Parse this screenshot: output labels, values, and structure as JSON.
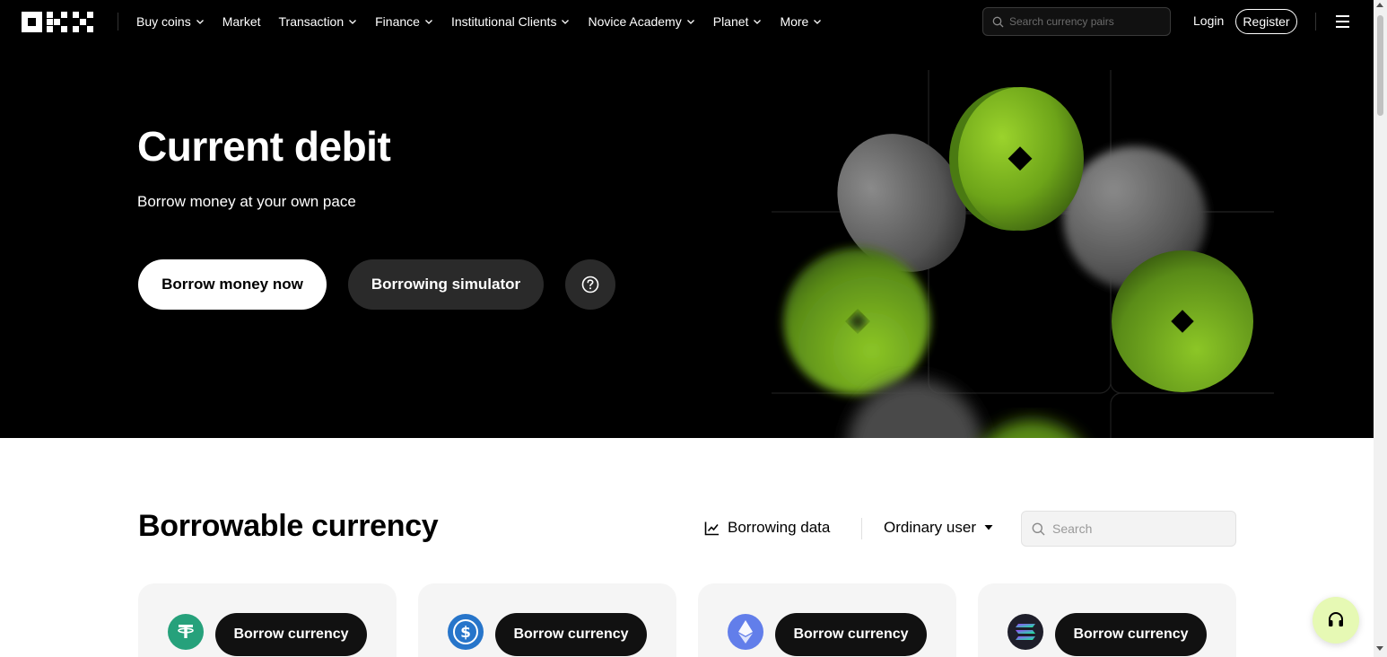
{
  "nav": {
    "items": [
      {
        "label": "Buy coins",
        "has_dropdown": true
      },
      {
        "label": "Market",
        "has_dropdown": false
      },
      {
        "label": "Transaction",
        "has_dropdown": true
      },
      {
        "label": "Finance",
        "has_dropdown": true
      },
      {
        "label": "Institutional Clients",
        "has_dropdown": true
      },
      {
        "label": "Novice Academy",
        "has_dropdown": true
      },
      {
        "label": "Planet",
        "has_dropdown": true
      },
      {
        "label": "More",
        "has_dropdown": true
      }
    ],
    "search_placeholder": "Search currency pairs",
    "login": "Login",
    "register": "Register"
  },
  "hero": {
    "title": "Current debit",
    "subtitle": "Borrow money at your own pace",
    "primary_button": "Borrow money now",
    "secondary_button": "Borrowing simulator",
    "accent_color": "#7cb518"
  },
  "section": {
    "title": "Borrowable currency",
    "borrowing_data": "Borrowing data",
    "user_type": "Ordinary user",
    "search_placeholder": "Search"
  },
  "cards": [
    {
      "icon": "tether-icon",
      "color": "#26a17b",
      "button": "Borrow currency"
    },
    {
      "icon": "usdc-icon",
      "color": "#2775ca",
      "button": "Borrow currency"
    },
    {
      "icon": "ethereum-icon",
      "color": "#627eea",
      "button": "Borrow currency"
    },
    {
      "icon": "solana-icon",
      "color": "#1e1e2a",
      "button": "Borrow currency"
    }
  ]
}
